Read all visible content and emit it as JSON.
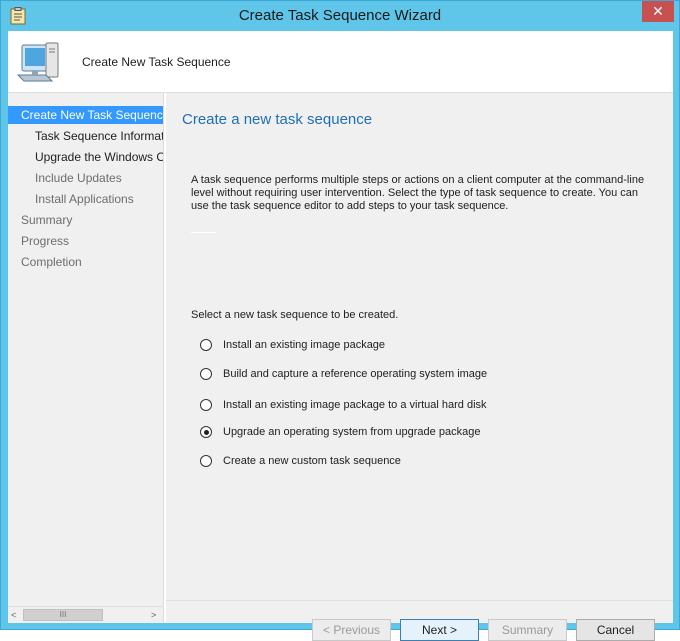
{
  "window": {
    "title": "Create Task Sequence Wizard",
    "close_label": "✕"
  },
  "header": {
    "title": "Create New Task Sequence"
  },
  "nav": {
    "items": [
      {
        "label": "Create New Task Sequence",
        "state": "selected"
      },
      {
        "label": "Task Sequence Information",
        "state": "bold"
      },
      {
        "label": "Upgrade the Windows Operating System",
        "state": "bold"
      },
      {
        "label": "Include Updates",
        "state": "dim"
      },
      {
        "label": "Install Applications",
        "state": "dim"
      },
      {
        "label": "Summary",
        "state": "dim"
      },
      {
        "label": "Progress",
        "state": "dim"
      },
      {
        "label": "Completion",
        "state": "dim"
      }
    ],
    "scroll_thumb": "III",
    "scroll_left": "<",
    "scroll_right": ">"
  },
  "main": {
    "title": "Create a new task sequence",
    "description": "A task sequence performs multiple steps or actions on a client computer at the command-line level without requiring user intervention. Select the type of task sequence to create. You can use the task sequence editor to add steps to your task sequence.",
    "prompt": "Select a new task sequence to be created.",
    "options": [
      {
        "label": "Install an existing image package",
        "checked": false
      },
      {
        "label": "Build and capture a reference operating system image",
        "checked": false
      },
      {
        "label": "Install an existing image package to a virtual hard disk",
        "checked": false
      },
      {
        "label": "Upgrade an operating system from upgrade package",
        "checked": true
      },
      {
        "label": "Create a new custom task sequence",
        "checked": false
      }
    ]
  },
  "buttons": {
    "previous": "< Previous",
    "next": "Next >",
    "summary": "Summary",
    "cancel": "Cancel"
  },
  "colors": {
    "title_bar": "#5fc6ea",
    "accent": "#3399ff",
    "page_title": "#1f6fb5",
    "close": "#c75050"
  },
  "icons": {
    "title": "clipboard-icon",
    "header": "computer-icon"
  }
}
